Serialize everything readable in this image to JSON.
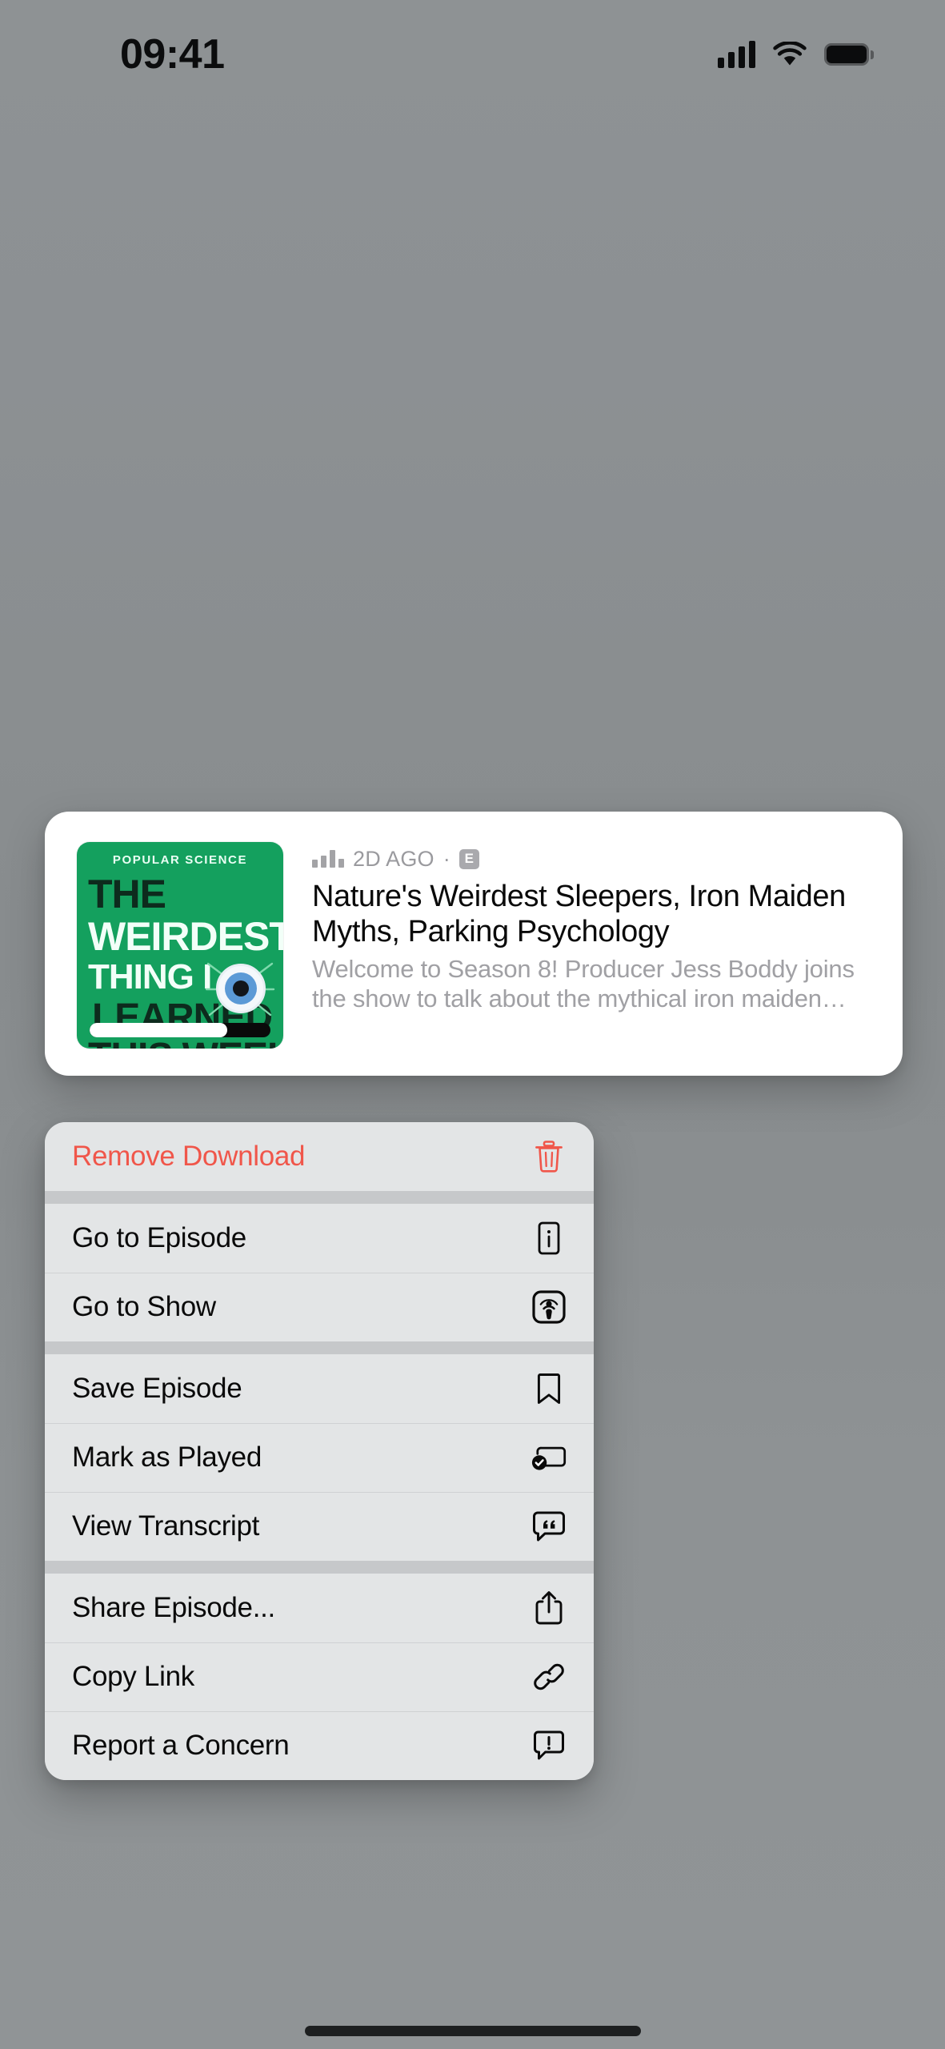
{
  "status_bar": {
    "time": "09:41",
    "cellular_icon": "cellular-bars-icon",
    "wifi_icon": "wifi-icon",
    "battery_icon": "battery-full-icon"
  },
  "episode_card": {
    "artwork": {
      "kicker": "POPULAR SCIENCE",
      "line1": "THE",
      "line2": "WEIRDEST",
      "line3": "THING I",
      "line4": "LEARNED",
      "line5": "THIS WEEK",
      "background_color": "#14a05e",
      "eye_icon": "eyeball-icon",
      "progress_percent": 76
    },
    "meta": {
      "chart_icon": "audio-bars-icon",
      "date": "2D AGO",
      "separator": "·",
      "explicit_badge": "E"
    },
    "title": "Nature's Weirdest Sleepers, Iron Maiden Myths, Parking Psychology",
    "description": "Welcome to Season 8! Producer Jess Boddy joins the show to talk about the mythical iron maiden…"
  },
  "context_menu": {
    "destructive_color": "#f0564a",
    "groups": [
      {
        "items": [
          {
            "label": "Remove Download",
            "icon": "trash-icon",
            "destructive": true
          }
        ]
      },
      {
        "items": [
          {
            "label": "Go to Episode",
            "icon": "info-square-icon",
            "destructive": false
          },
          {
            "label": "Go to Show",
            "icon": "podcast-icon",
            "destructive": false
          }
        ]
      },
      {
        "items": [
          {
            "label": "Save Episode",
            "icon": "bookmark-icon",
            "destructive": false
          },
          {
            "label": "Mark as Played",
            "icon": "rectangle-badge-checkmark-icon",
            "destructive": false
          },
          {
            "label": "View Transcript",
            "icon": "quote-bubble-icon",
            "destructive": false
          }
        ]
      },
      {
        "items": [
          {
            "label": "Share Episode...",
            "icon": "share-icon",
            "destructive": false
          },
          {
            "label": "Copy Link",
            "icon": "link-icon",
            "destructive": false
          },
          {
            "label": "Report a Concern",
            "icon": "exclamation-bubble-icon",
            "destructive": false
          }
        ]
      }
    ]
  },
  "home_indicator": {
    "name": "home-indicator"
  }
}
